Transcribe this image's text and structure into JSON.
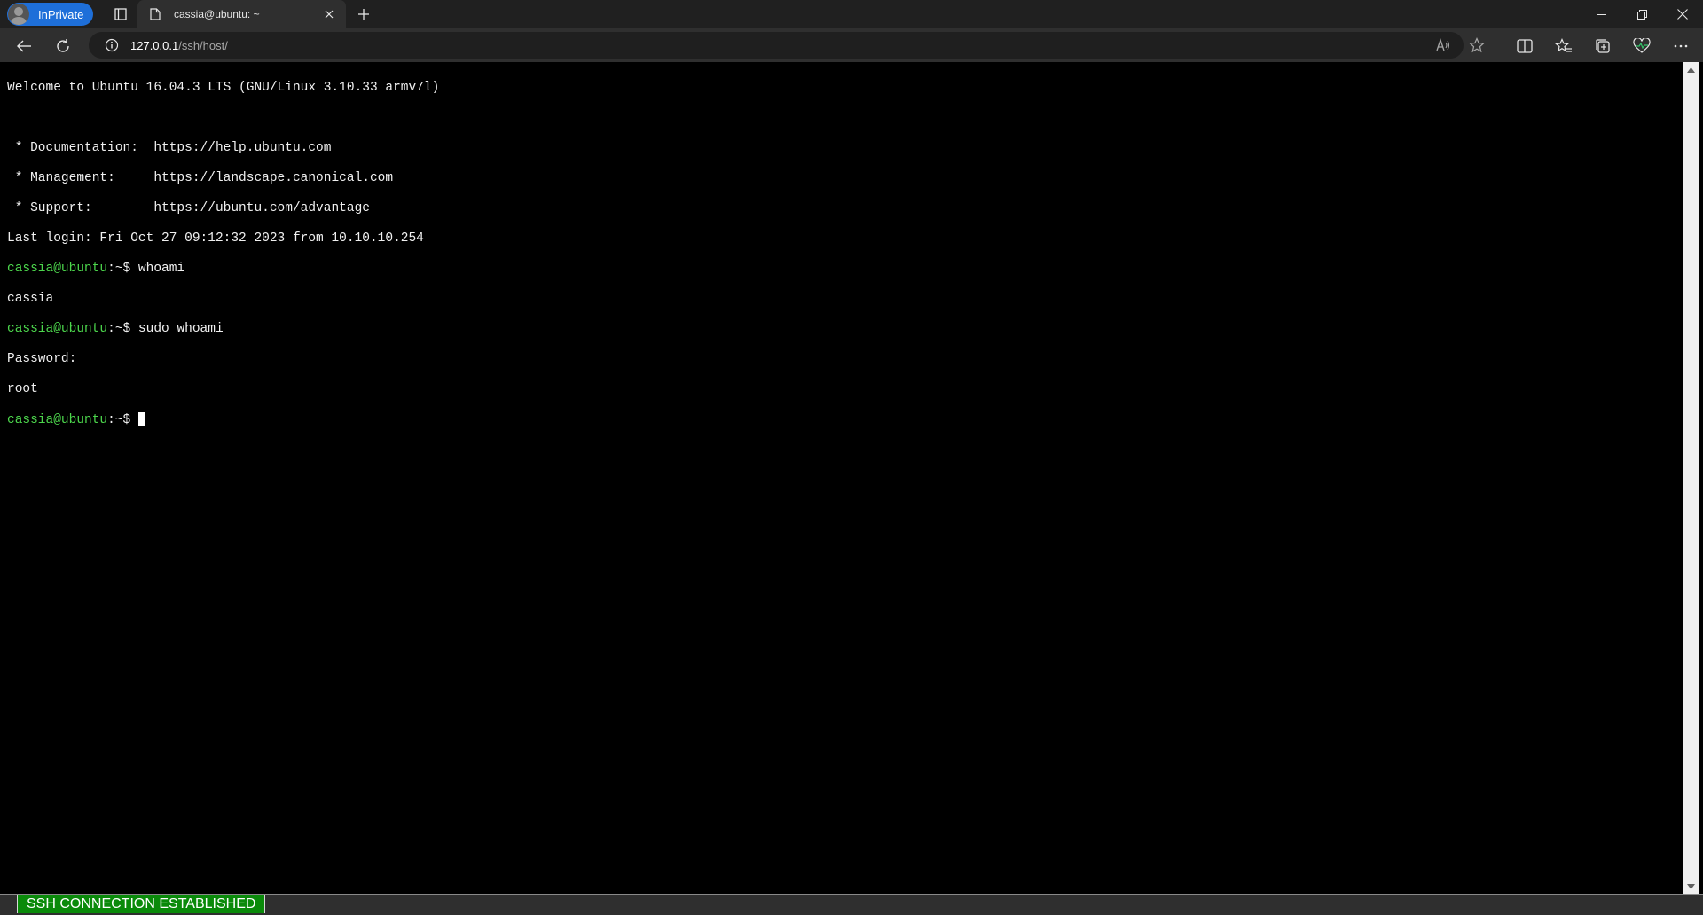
{
  "browser": {
    "inprivate_label": "InPrivate",
    "tab_title": "cassia@ubuntu: ~",
    "url_host": "127.0.0.1",
    "url_path": "/ssh/host/"
  },
  "terminal": {
    "lines": {
      "l0": "Welcome to Ubuntu 16.04.3 LTS (GNU/Linux 3.10.33 armv7l)",
      "l1": "",
      "l2": " * Documentation:  https://help.ubuntu.com",
      "l3": " * Management:     https://landscape.canonical.com",
      "l4": " * Support:        https://ubuntu.com/advantage",
      "l5": "Last login: Fri Oct 27 09:12:32 2023 from 10.10.10.254",
      "l6_prompt": "cassia@ubuntu",
      "l6_rest": ":~$ whoami",
      "l7": "cassia",
      "l8_prompt": "cassia@ubuntu",
      "l8_rest": ":~$ sudo whoami",
      "l9": "Password:",
      "l10": "root",
      "l11_prompt": "cassia@ubuntu",
      "l11_rest": ":~$ "
    }
  },
  "status": {
    "connection": "SSH CONNECTION ESTABLISHED"
  },
  "colors": {
    "prompt_green": "#4cd64c",
    "status_green": "#0a8a0a",
    "inprivate_blue": "#1e6fd9"
  }
}
